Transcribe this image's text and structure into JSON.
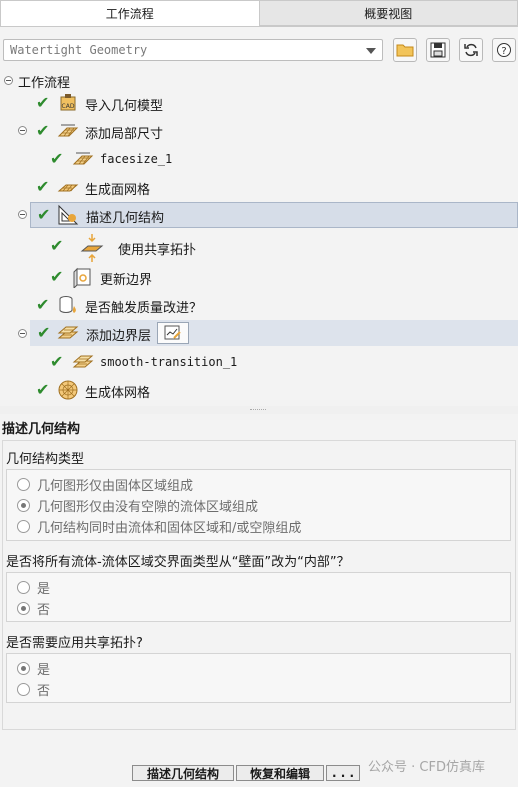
{
  "tabs": {
    "workflow": "工作流程",
    "overview": "概要视图"
  },
  "toolbar": {
    "workflow_select": "Watertight Geometry"
  },
  "tree": {
    "root": "工作流程",
    "items": [
      {
        "label": "导入几何模型"
      },
      {
        "label": "添加局部尺寸"
      },
      {
        "label": "facesize_1"
      },
      {
        "label": "生成面网格"
      },
      {
        "label": "描述几何结构"
      },
      {
        "label": "使用共享拓扑"
      },
      {
        "label": "更新边界"
      },
      {
        "label": "是否触发质量改进？"
      },
      {
        "label": "添加边界层"
      },
      {
        "label": "smooth-transition_1"
      },
      {
        "label": "生成体网格"
      }
    ]
  },
  "panel": {
    "title": "描述几何结构",
    "geometry_type": {
      "label": "几何结构类型",
      "options": [
        "几何图形仅由固体区域组成",
        "几何图形仅由没有空隙的流体区域组成",
        "几何结构同时由流体和固体区域和/或空隙组成"
      ],
      "selected_index": 1
    },
    "interface_question": {
      "label": "是否将所有流体-流体区域交界面类型从“壁面”改为“内部”？",
      "options": [
        "是",
        "否"
      ],
      "selected_index": 1
    },
    "shared_topology": {
      "label": "是否需要应用共享拓扑?",
      "options": [
        "是",
        "否"
      ],
      "selected_index": 0
    }
  },
  "buttons": {
    "describe": "描述几何结构",
    "revert": "恢复和编辑",
    "more": ". . ."
  },
  "watermark": "公众号 · CFD仿真库",
  "colors": {
    "check": "#2e8b2e",
    "selected_row": "#d6dde8",
    "icon_orange": "#e8a53a"
  }
}
